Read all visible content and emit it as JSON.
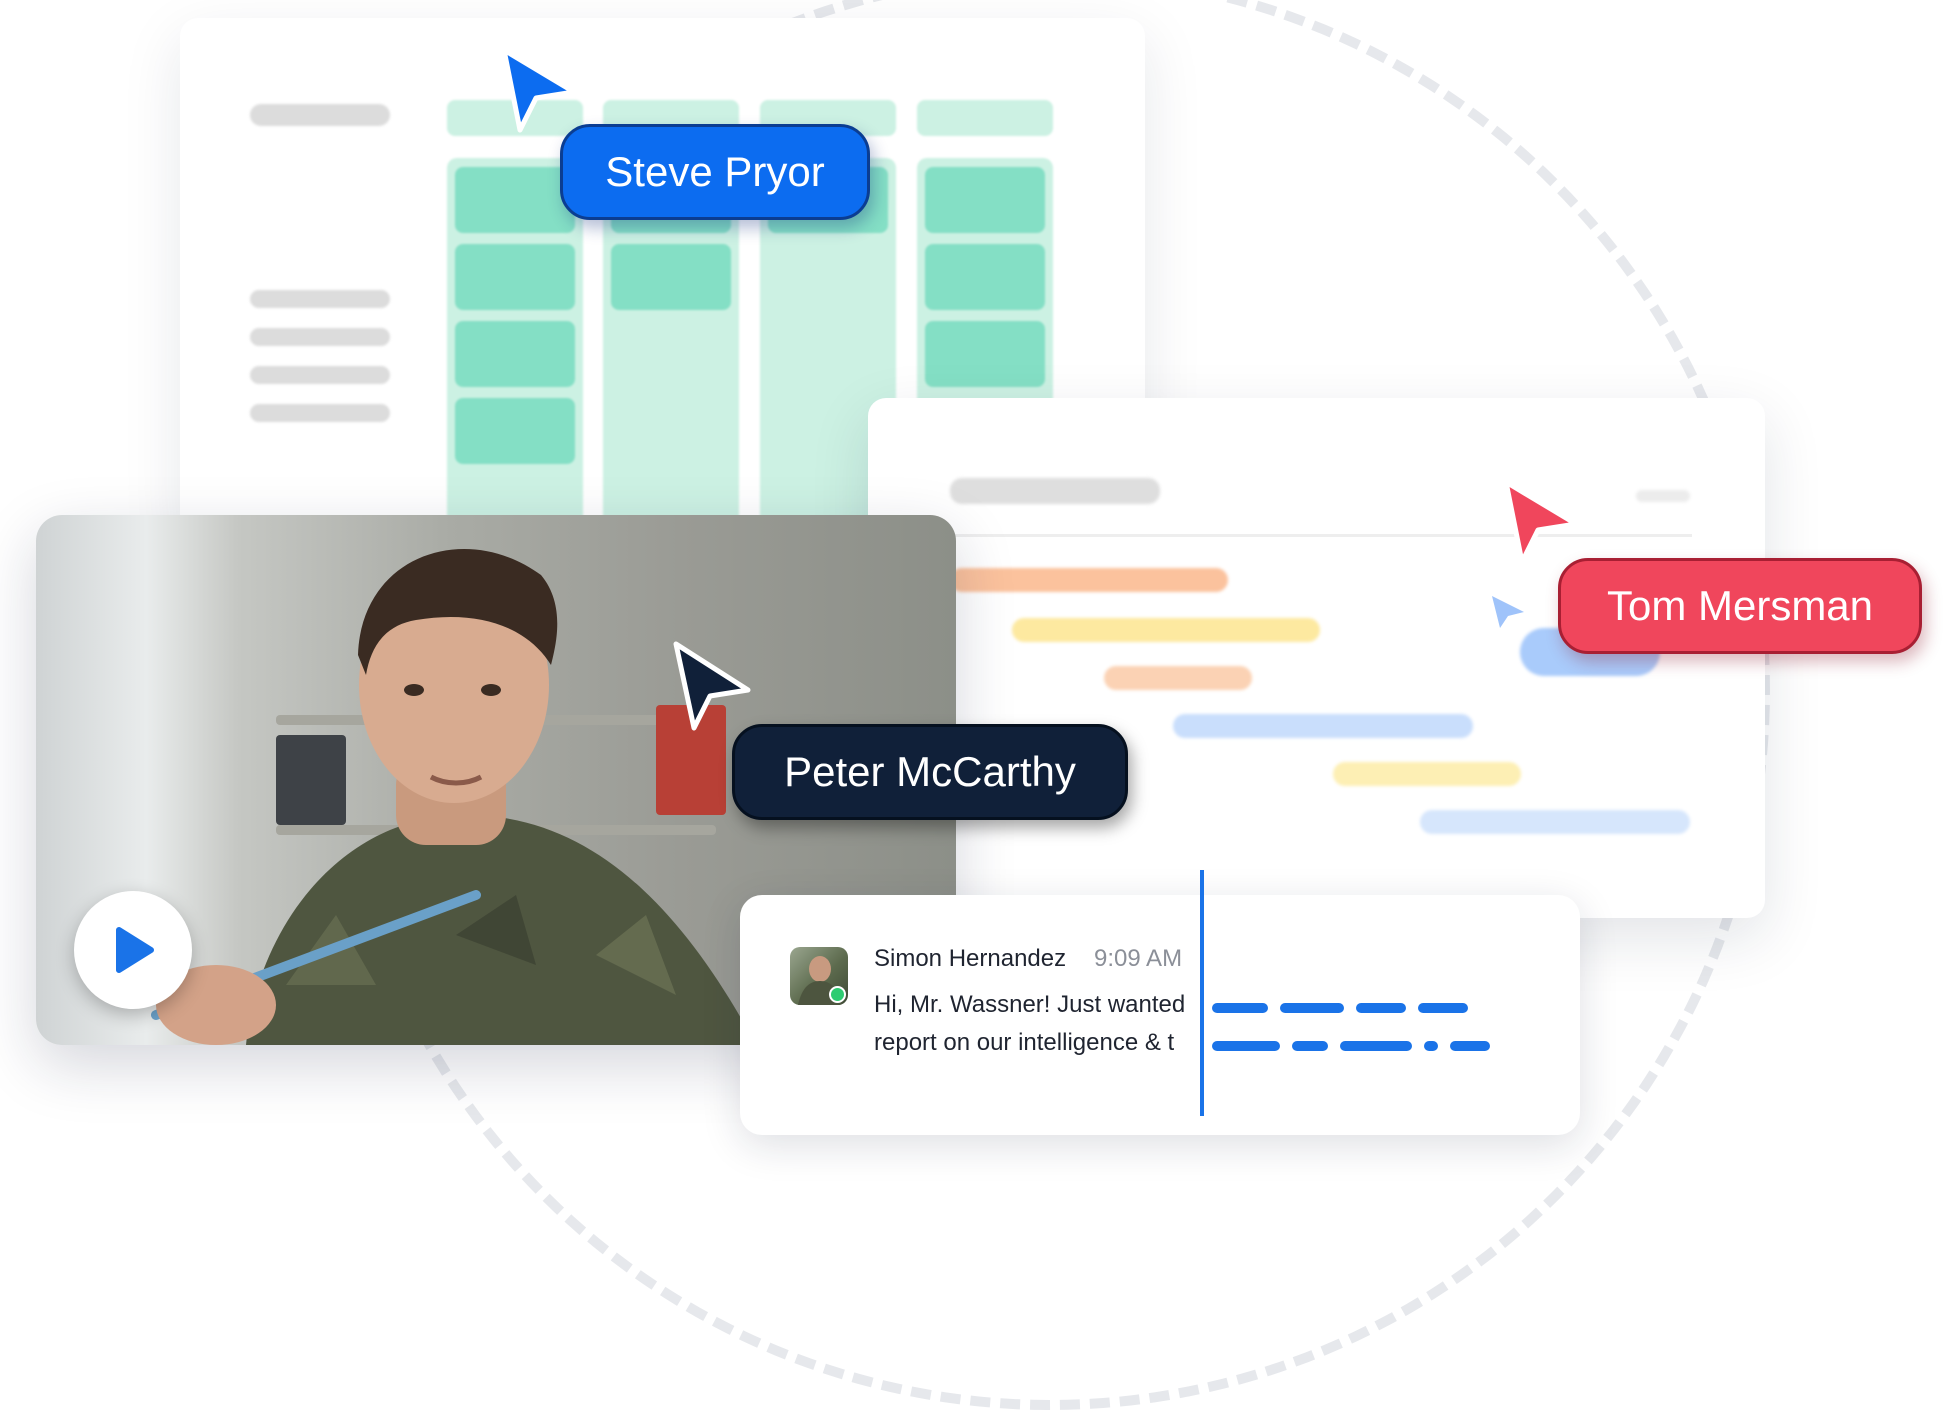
{
  "cursors": [
    {
      "name": "Steve Pryor",
      "color": "#0c6cf0"
    },
    {
      "name": "Tom Mersman",
      "color": "#f0465c"
    },
    {
      "name": "Peter McCarthy",
      "color": "#102039"
    }
  ],
  "chat": {
    "sender": "Simon Hernandez",
    "time": "9:09 AM",
    "line1": "Hi, Mr. Wassner! Just wanted",
    "line2": "report on our intelligence & t"
  },
  "colors": {
    "kanban_column": "#ccf1e3",
    "kanban_tile": "#84dfc5",
    "gantt_orange": "#fbc29d",
    "gantt_yellow": "#fde9a0",
    "gantt_blue": "#c9defc",
    "accent_blue": "#1a73e8"
  },
  "icons": [
    "cursor-arrow-icon",
    "play-icon",
    "online-status-icon"
  ]
}
